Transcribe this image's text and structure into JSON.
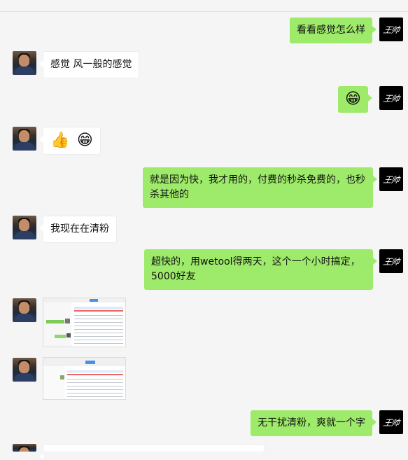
{
  "messages": [
    {
      "side": "me",
      "text": "看看感觉怎么样"
    },
    {
      "side": "other",
      "text": "感觉 风一般的感觉"
    },
    {
      "side": "me",
      "emoji": "😁",
      "emoji_name": "grin-emoji"
    },
    {
      "side": "other",
      "emoji1": "👍",
      "emoji2": "😁"
    },
    {
      "side": "me",
      "text": "就是因为快，我才用的，付费的秒杀免费的，也秒杀其他的"
    },
    {
      "side": "other",
      "text": "我现在在清粉"
    },
    {
      "side": "me",
      "text": "超快的，用wetool得两天，这个一个小时搞定，5000好友"
    },
    {
      "side": "other",
      "image": "screenshot-thumbnail"
    },
    {
      "side": "other",
      "image": "screenshot-thumbnail"
    },
    {
      "side": "me",
      "text": "无干扰清粉，爽就一个字"
    }
  ],
  "me_avatar_text": "王帅",
  "colors": {
    "me_bubble": "#9eea6a",
    "other_bubble": "#ffffff",
    "background": "#f5f5f5"
  }
}
